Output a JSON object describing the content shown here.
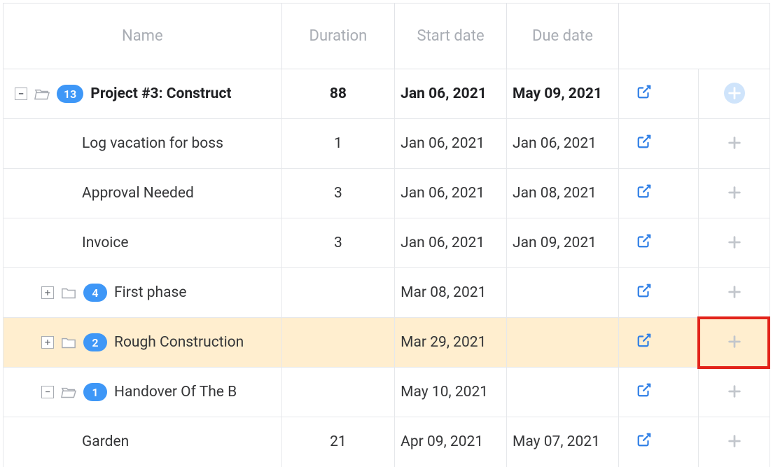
{
  "headers": {
    "name": "Name",
    "duration": "Duration",
    "start": "Start date",
    "due": "Due date"
  },
  "rows": [
    {
      "indent": 0,
      "expander": "minus",
      "folder": "open",
      "badge": "13",
      "label": "Project #3: Construct",
      "duration": "88",
      "start": "Jan 06, 2021",
      "due": "May 09, 2021",
      "bold": true,
      "plusCircle": true
    },
    {
      "indent": 2,
      "expander": "",
      "folder": "",
      "badge": "",
      "label": "Log vacation for boss",
      "duration": "1",
      "start": "Jan 06, 2021",
      "due": "Jan 06, 2021"
    },
    {
      "indent": 2,
      "expander": "",
      "folder": "",
      "badge": "",
      "label": "Approval Needed",
      "duration": "3",
      "start": "Jan 06, 2021",
      "due": "Jan 08, 2021"
    },
    {
      "indent": 2,
      "expander": "",
      "folder": "",
      "badge": "",
      "label": "Invoice",
      "duration": "3",
      "start": "Jan 06, 2021",
      "due": "Jan 09, 2021"
    },
    {
      "indent": 1,
      "expander": "plus",
      "folder": "closed",
      "badge": "4",
      "label": "First phase",
      "duration": "",
      "start": "Mar 08, 2021",
      "due": ""
    },
    {
      "indent": 1,
      "expander": "plus",
      "folder": "closed",
      "badge": "2",
      "label": "Rough Construction",
      "duration": "",
      "start": "Mar 29, 2021",
      "due": "",
      "highlighted": true,
      "addHighlight": true
    },
    {
      "indent": 1,
      "expander": "minus",
      "folder": "open",
      "badge": "1",
      "label": "Handover Of The B",
      "duration": "",
      "start": "May 10, 2021",
      "due": ""
    },
    {
      "indent": 2,
      "expander": "",
      "folder": "",
      "badge": "",
      "label": "Garden",
      "duration": "21",
      "start": "Apr 09, 2021",
      "due": "May 07, 2021",
      "lastRow": true
    }
  ]
}
